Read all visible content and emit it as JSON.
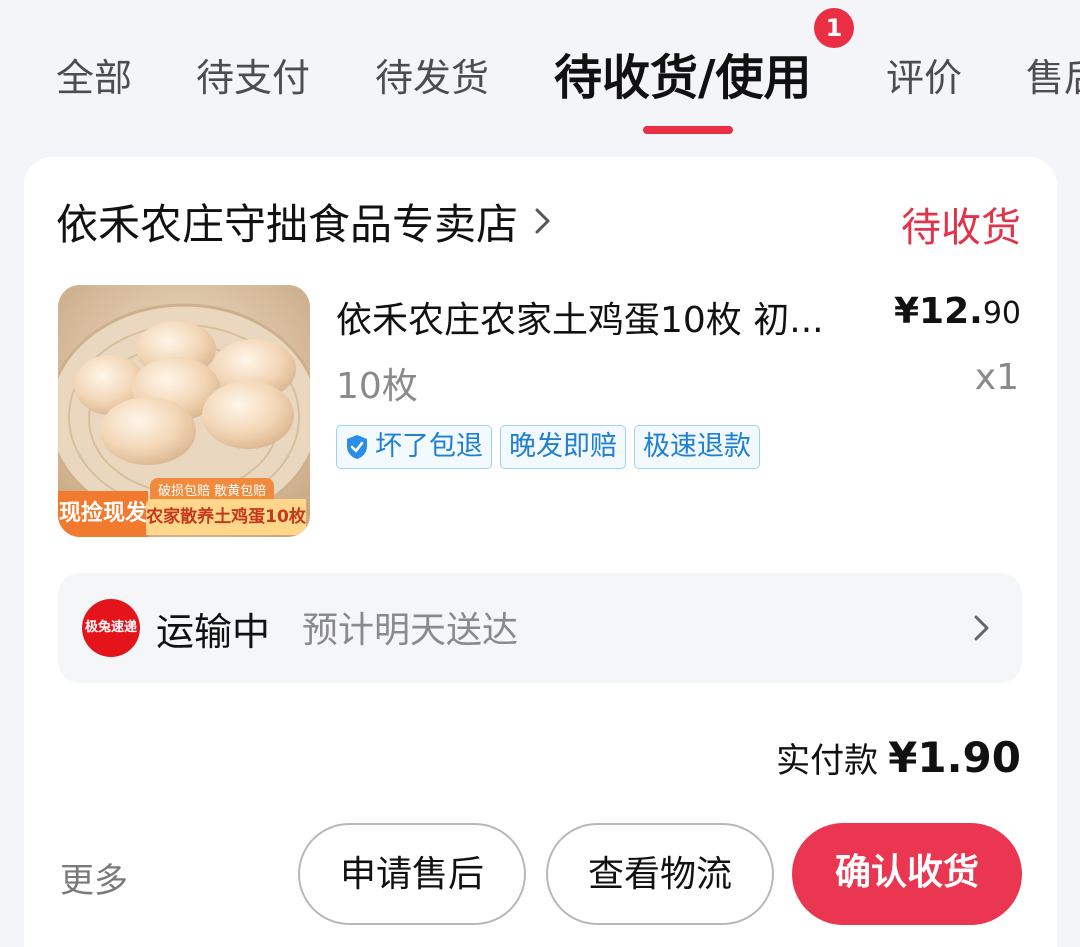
{
  "tabs": {
    "items": [
      {
        "label": "全部"
      },
      {
        "label": "待支付"
      },
      {
        "label": "待发货"
      },
      {
        "label": "待收货/使用",
        "badge": "1"
      },
      {
        "label": "评价"
      },
      {
        "label": "售后"
      }
    ],
    "active": "待收货/使用"
  },
  "order": {
    "store_name": "依禾农庄守拙食品专卖店",
    "status": "待收货",
    "product": {
      "title": "依禾农庄农家土鸡蛋10枚 初...",
      "price_currency": "¥",
      "price_integer": "12.",
      "price_decimal": "90",
      "spec": "10枚",
      "quantity": "x1",
      "image_badges": {
        "left": "现捡现发",
        "top": "破损包赔 散黄包赔",
        "right": "农家散养土鸡蛋10枚"
      },
      "tags": [
        "坏了包退",
        "晚发即赔",
        "极速退款"
      ]
    },
    "logistics": {
      "courier_logo_text": "极兔速递",
      "status": "运输中",
      "eta": "预计明天送达"
    },
    "total": {
      "label": "实付款",
      "amount": "¥1.90"
    },
    "actions": {
      "more": "更多",
      "aftersale": "申请售后",
      "track": "查看物流",
      "confirm": "确认收货"
    }
  },
  "colors": {
    "accent": "#ea2e43",
    "background": "#f4f5f9",
    "tag_text": "#1f7fd1"
  }
}
